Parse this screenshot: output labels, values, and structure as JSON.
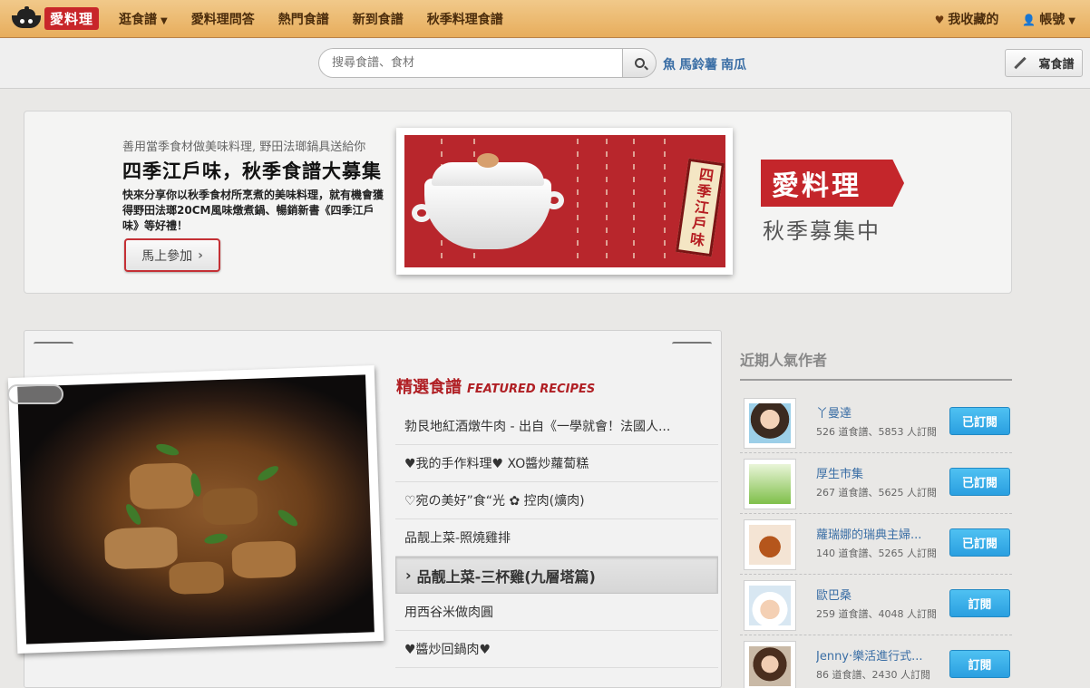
{
  "nav": {
    "logo_text": "愛料理",
    "items": [
      {
        "label": "逛食譜",
        "has_caret": true
      },
      {
        "label": "愛料理問答"
      },
      {
        "label": "熱門食譜"
      },
      {
        "label": "新到食譜"
      },
      {
        "label": "秋季料理食譜"
      }
    ],
    "favorites": "我收藏的",
    "account": "帳號"
  },
  "search": {
    "placeholder": "搜尋食譜、食材",
    "quick_tags": [
      "魚",
      "馬鈴薯",
      "南瓜"
    ],
    "write_label": "寫食譜"
  },
  "banner": {
    "subtitle": "善用當季食材做美味料理, 野田法瑯鍋具送給你",
    "title": "四季江戶味，秋季食譜大募集",
    "description": "快來分享你以秋季食材所烹煮的美味料理，就有機會獲得野田法瑯20CM風味燉煮鍋、暢銷新書《四季江戶味》等好禮！",
    "join_label": "馬上參加",
    "edo_tag": "四季江戶味",
    "logo_text": "愛料理",
    "logo_sub": "秋季募集中"
  },
  "featured": {
    "title_zh": "精選食譜",
    "title_en": "FEATURED RECIPES",
    "recipes": [
      "勃艮地紅酒燉牛肉 - 出自《一學就會！法國人...",
      "♥我的手作料理♥ XO醬炒蘿蔔糕",
      "♡宛の美好”食“光 ✿ 控肉(爌肉)",
      "品靓上菜-照燒雞排",
      "品靓上菜-三杯雞(九層塔篇)",
      "用西谷米做肉圓",
      "♥醬炒回鍋肉♥"
    ],
    "active_index": 4
  },
  "sidebar": {
    "title": "近期人氣作者",
    "authors": [
      {
        "name": "丫曼達",
        "stats": "526 道食譜、5853 人訂閱",
        "button": "已訂閱"
      },
      {
        "name": "厚生市集",
        "stats": "267 道食譜、5625 人訂閱",
        "button": "已訂閱"
      },
      {
        "name": "蘿瑞娜的瑞典主婦...",
        "stats": "140 道食譜、5265 人訂閱",
        "button": "已訂閱"
      },
      {
        "name": "歐巴桑",
        "stats": "259 道食譜、4048 人訂閱",
        "button": "訂閱"
      },
      {
        "name": "Jenny·樂活進行式...",
        "stats": "86 道食譜、2430 人訂閱",
        "button": "訂閱"
      }
    ]
  },
  "colors": {
    "brand_red": "#c4262b",
    "nav_orange": "#e7ad5c",
    "link_blue": "#3a6ea5",
    "subscribe_blue": "#2a9fe0"
  }
}
